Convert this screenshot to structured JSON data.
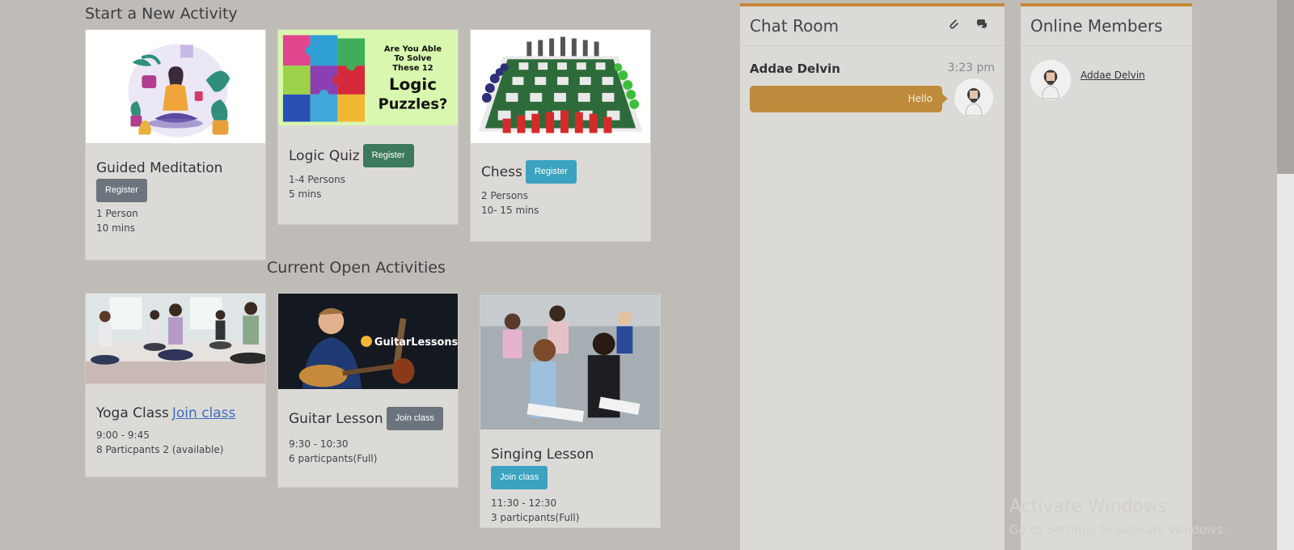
{
  "new_activity": {
    "heading": "Start a New Activity",
    "cards": [
      {
        "title": "Guided Meditation",
        "button": "Register",
        "line1": "1 Person",
        "line2": "10 mins"
      },
      {
        "title": "Logic Quiz",
        "button": "Register",
        "line1": "1-4 Persons",
        "line2": "5 mins",
        "image_text": [
          "Are You Able",
          "To Solve",
          "These 12",
          "Logic",
          "Puzzles?"
        ]
      },
      {
        "title": "Chess",
        "button": "Register",
        "line1": "2 Persons",
        "line2": "10- 15 mins"
      }
    ]
  },
  "open_activities": {
    "heading": "Current Open Activities",
    "cards": [
      {
        "title": "Yoga Class",
        "link": "Join class",
        "line1": "9:00 - 9:45",
        "line2": "8 Particpants 2 (available)"
      },
      {
        "title": "Guitar Lesson",
        "button": "Join class",
        "line1": "9:30 - 10:30",
        "line2": "6 particpants(Full)",
        "image_text": "GuitarLessons"
      },
      {
        "title": "Singing Lesson",
        "button": "Join class",
        "line1": "11:30 - 12:30",
        "line2": "3 particpants(Full)"
      }
    ]
  },
  "chat": {
    "title": "Chat Room",
    "icons": [
      "paperclip-icon",
      "comments-icon"
    ],
    "messages": [
      {
        "sender": "Addae Delvin",
        "time": "3:23 pm",
        "text": "Hello"
      }
    ]
  },
  "members": {
    "title": "Online Members",
    "list": [
      {
        "name": "Addae Delvin"
      }
    ]
  },
  "watermark": {
    "line1": "Activate Windows",
    "line2": "Go to Settings to activate Windows."
  },
  "colors": {
    "background": "#bfbcb8",
    "card": "#dcdad6",
    "accent": "#c4883a",
    "btn_gray": "#6c757d",
    "btn_green": "#3d7a5c",
    "btn_teal": "#3ba3bf"
  }
}
